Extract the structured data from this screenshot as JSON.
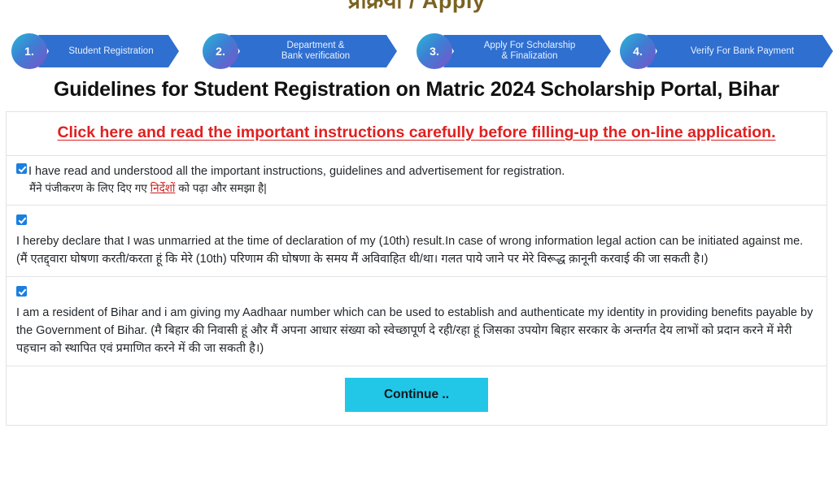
{
  "banner": {
    "cut_off_title": "प्रक्रिया / Apply"
  },
  "stepper": {
    "steps": [
      {
        "num": "1.",
        "label": "Student Registration"
      },
      {
        "num": "2.",
        "label": "Department &\nBank verification"
      },
      {
        "num": "3.",
        "label": "Apply For Scholarship\n& Finalization"
      },
      {
        "num": "4.",
        "label": "Verify For Bank Payment"
      }
    ],
    "accent_start": "#2ab7d6",
    "accent_end": "#7b52c9",
    "bar_color": "#2f6fd0"
  },
  "page": {
    "title": "Guidelines for Student Registration on Matric 2024 Scholarship Portal, Bihar"
  },
  "instructions": {
    "link_text": "Click here and read the important instructions carefully before filling-up the on-line application.",
    "link_color": "#e02020"
  },
  "declarations": [
    {
      "checked": true,
      "english": "I have read and understood all the important instructions, guidelines and advertisement for registration.",
      "hindi_before": "मैंने पंजीकरण के लिए दिए गए ",
      "hindi_link": "निर्देशों",
      "hindi_after": " को पढ़ा और समझा है|"
    },
    {
      "checked": true,
      "text": "I hereby declare that I was unmarried at the time of declaration of my (10th) result.In case of wrong information legal action can be initiated against me. (मैं एतद्द्वारा घोषणा करती/करता हूं कि मेरे (10th) परिणाम की घोषणा के समय मैं अविवाहित थी/था। गलत पाये जाने पर मेरे विरूद्ध क़ानूनी करवाई की जा सकती है।)"
    },
    {
      "checked": true,
      "text": "I am a resident of Bihar and i am giving my Aadhaar number which can be used to establish and authenticate my identity in providing benefits payable by the Government of Bihar. (मै बिहार की निवासी हूं और मैं अपना आधार संख्या को स्वेच्छापूर्ण दे रही/रहा हूं जिसका उपयोग बिहार सरकार के अन्तर्गत देय लाभों को प्रदान करने में मेरी पहचान को स्थापित एवं प्रमाणित करने में की जा सकती है।)"
    }
  ],
  "footer": {
    "continue_label": "Continue ..",
    "continue_color": "#22c7e8"
  }
}
